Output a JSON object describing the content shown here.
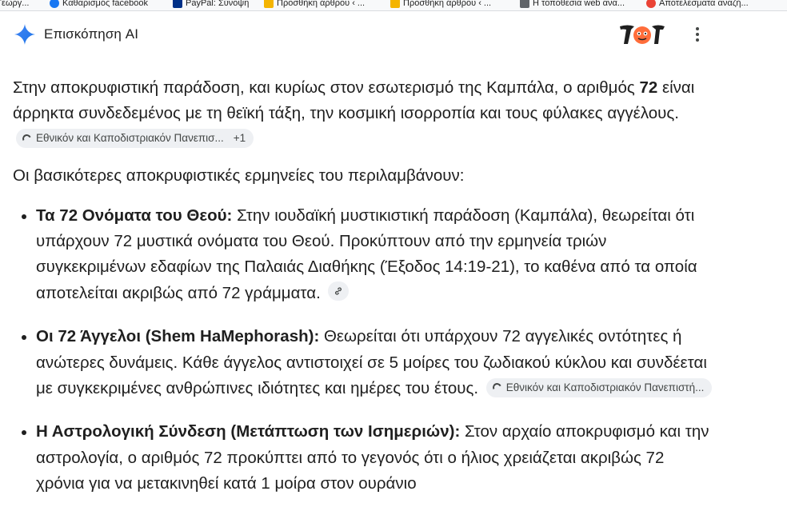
{
  "bookmarks": [
    {
      "label": "Γεωργ...",
      "color": "#9aa0a6"
    },
    {
      "label": "Καθαρισμός facebook",
      "color": "#1877f2"
    },
    {
      "label": "PayPal: Σύνοψη",
      "color": "#003087"
    },
    {
      "label": "Προσθήκη άρθρου ‹ ...",
      "color": "#f4b400"
    },
    {
      "label": "Προσθήκη άρθρου ‹ ...",
      "color": "#f4b400"
    },
    {
      "label": "Η τοποθεσία web ανα...",
      "color": "#5f6368"
    },
    {
      "label": "Αποτελέσματα αναζή...",
      "color": "#ea4335"
    }
  ],
  "header": {
    "title": "Επισκόπηση AI",
    "menu_icon": "kebab-menu-icon"
  },
  "intro": {
    "text_before": "Στην αποκρυφιστική παράδοση, και κυρίως στον εσωτερισμό της Καμπάλα, ο αριθμός ",
    "bold": "72",
    "text_after": " είναι άρρηκτα συνδεδεμένος με τη θεϊκή τάξη, την κοσμική ισορροπία και τους φύλακες αγγέλους.",
    "source_chip": "Εθνικόν και Καποδιστριακόν Πανεπισ...",
    "source_more": "+1"
  },
  "lead": "Οι βασικότερες αποκρυφιστικές ερμηνείες του περιλαμβάνουν:",
  "items": [
    {
      "title": "Τα 72 Ονόματα του Θεού:",
      "text": " Στην ιουδαϊκή μυστικιστική παράδοση (Καμπάλα), θεωρείται ότι υπάρχουν 72 μυστικά ονόματα του Θεού. Προκύπτουν από την ερμηνεία τριών συγκεκριμένων εδαφίων της Παλαιάς Διαθήκης (Έξοδος 14:19-21), το καθένα από τα οποία αποτελείται ακριβώς από 72 γράμματα."
    },
    {
      "title": "Οι 72 Άγγελοι (Shem HaMephorash):",
      "text": " Θεωρείται ότι υπάρχουν 72 αγγελικές οντότητες ή ανώτερες δυνάμεις. Κάθε άγγελος αντιστοιχεί σε 5 μοίρες του ζωδιακού κύκλου και συνδέεται με συγκεκριμένες ανθρώπινες ιδιότητες και ημέρες του έτους.",
      "source_chip": "Εθνικόν και Καποδιστριακόν Πανεπιστή..."
    },
    {
      "title": "Η Αστρολογική Σύνδεση (Μετάπτωση των Ισημεριών):",
      "text": " Στον αρχαίο αποκρυφισμό και την αστρολογία, ο αριθμός 72 προκύπτει από το γεγονός ότι ο ήλιος χρειάζεται ακριβώς 72 χρόνια για να μετακινηθεί κατά 1 μοίρα στον ουράνιο"
    }
  ]
}
